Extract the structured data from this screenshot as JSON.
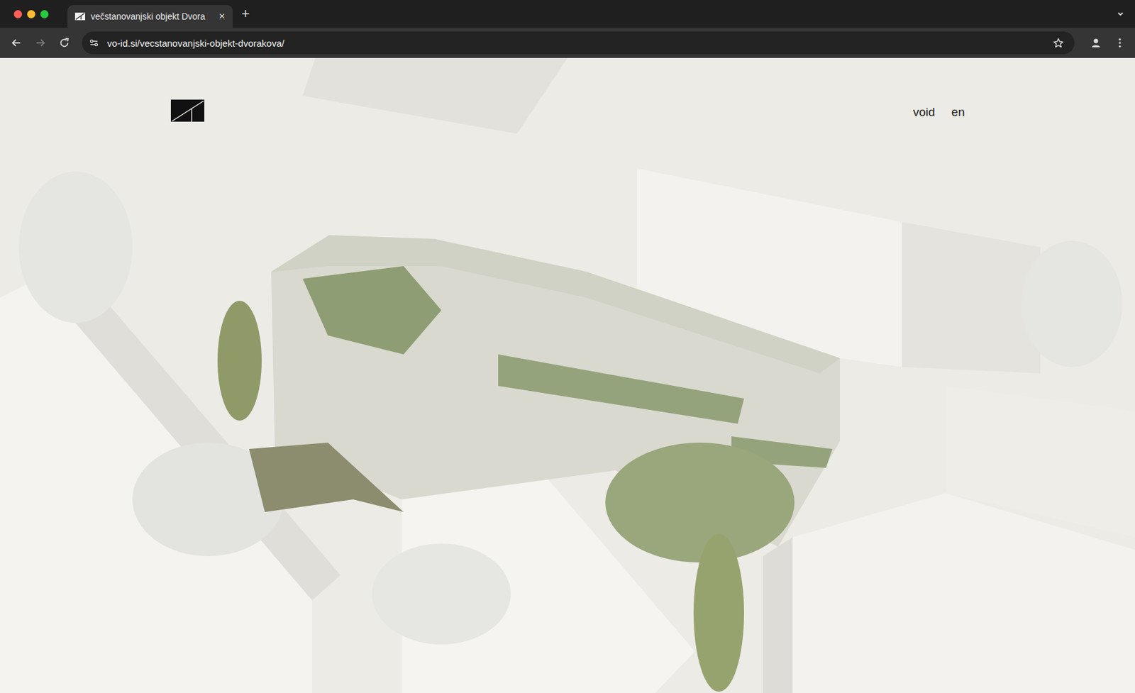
{
  "window": {
    "tabs": [
      {
        "label": "večstanovanjski objekt Dvora",
        "selected": true,
        "close": "×"
      }
    ],
    "new_tab": "+",
    "navigation": {
      "back_enabled": true,
      "forward_enabled": false
    },
    "address": "vo-id.si/vecstanovanjski-objekt-dvorakova/"
  },
  "page": {
    "nav": [
      "void",
      "en"
    ]
  }
}
